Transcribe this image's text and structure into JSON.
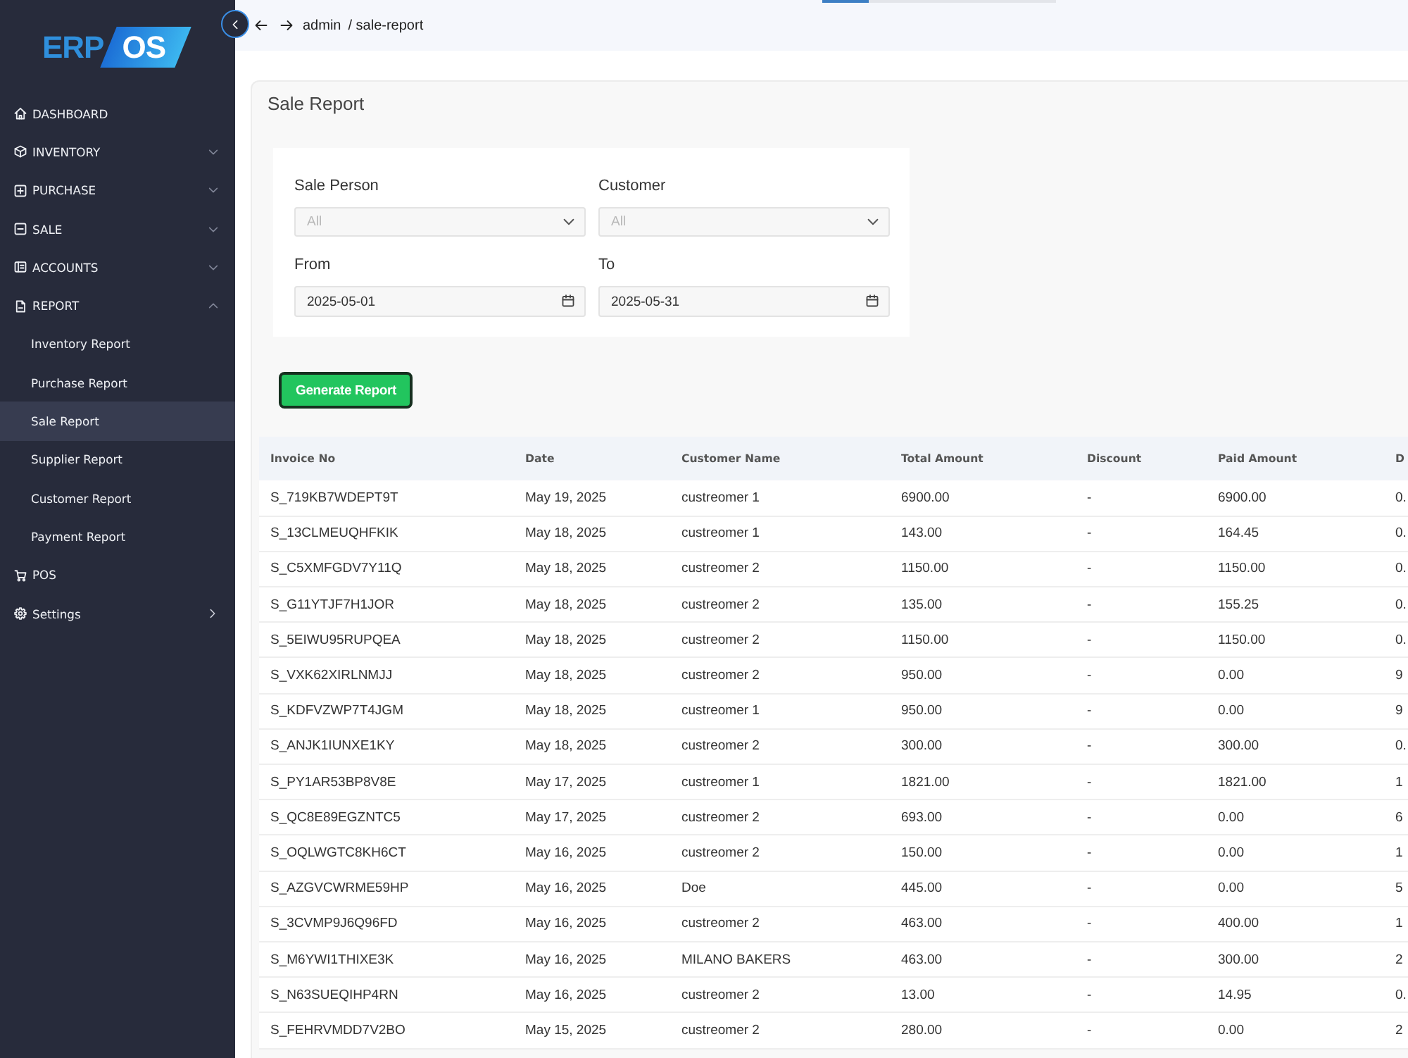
{
  "top_progress": {
    "level": 0.2
  },
  "sidebar": {
    "logo": {
      "text": "ERP",
      "badge": "OS"
    },
    "items": [
      {
        "label": "DASHBOARD",
        "kind": "link"
      },
      {
        "label": "INVENTORY",
        "kind": "group",
        "expanded": false
      },
      {
        "label": "PURCHASE",
        "kind": "group",
        "expanded": false
      },
      {
        "label": "SALE",
        "kind": "group",
        "expanded": false
      },
      {
        "label": "ACCOUNTS",
        "kind": "group",
        "expanded": false
      },
      {
        "label": "REPORT",
        "kind": "group",
        "expanded": true,
        "children": [
          {
            "label": "Inventory Report",
            "selected": false
          },
          {
            "label": "Purchase Report",
            "selected": false
          },
          {
            "label": "Sale Report",
            "selected": true
          },
          {
            "label": "Supplier Report",
            "selected": false
          },
          {
            "label": "Customer Report",
            "selected": false
          },
          {
            "label": "Payment Report",
            "selected": false
          }
        ]
      },
      {
        "label": "POS",
        "kind": "link"
      },
      {
        "label": "Settings",
        "kind": "flyout"
      }
    ]
  },
  "topbar": {
    "breadcrumb": {
      "user": "admin",
      "path": "/ sale-report"
    }
  },
  "page": {
    "title": "Sale Report",
    "filters": [
      {
        "label": "Sale Person",
        "kind": "select",
        "placeholder": "All"
      },
      {
        "label": "Customer",
        "kind": "select",
        "placeholder": "All"
      },
      {
        "label": "From",
        "kind": "date",
        "value": "2025-05-01"
      },
      {
        "label": "To",
        "kind": "date",
        "value": "2025-05-31"
      }
    ],
    "generate_button": "Generate Report",
    "table": {
      "columns": [
        "Invoice No",
        "Date",
        "Customer Name",
        "Total Amount",
        "Discount",
        "Paid Amount",
        "D"
      ],
      "rows": [
        [
          "S_719KB7WDEPT9T",
          "May 19, 2025",
          "custreomer 1",
          "6900.00",
          "-",
          "6900.00",
          "0."
        ],
        [
          "S_13CLMEUQHFKIK",
          "May 18, 2025",
          "custreomer 1",
          "143.00",
          "-",
          "164.45",
          "0."
        ],
        [
          "S_C5XMFGDV7Y11Q",
          "May 18, 2025",
          "custreomer 2",
          "1150.00",
          "-",
          "1150.00",
          "0."
        ],
        [
          "S_G11YTJF7H1JOR",
          "May 18, 2025",
          "custreomer 2",
          "135.00",
          "-",
          "155.25",
          "0."
        ],
        [
          "S_5EIWU95RUPQEA",
          "May 18, 2025",
          "custreomer 2",
          "1150.00",
          "-",
          "1150.00",
          "0."
        ],
        [
          "S_VXK62XIRLNMJJ",
          "May 18, 2025",
          "custreomer 2",
          "950.00",
          "-",
          "0.00",
          "9"
        ],
        [
          "S_KDFVZWP7T4JGM",
          "May 18, 2025",
          "custreomer 1",
          "950.00",
          "-",
          "0.00",
          "9"
        ],
        [
          "S_ANJK1IUNXE1KY",
          "May 18, 2025",
          "custreomer 2",
          "300.00",
          "-",
          "300.00",
          "0."
        ],
        [
          "S_PY1AR53BP8V8E",
          "May 17, 2025",
          "custreomer 1",
          "1821.00",
          "-",
          "1821.00",
          "1"
        ],
        [
          "S_QC8E89EGZNTC5",
          "May 17, 2025",
          "custreomer 2",
          "693.00",
          "-",
          "0.00",
          "6"
        ],
        [
          "S_OQLWGTC8KH6CT",
          "May 16, 2025",
          "custreomer 2",
          "150.00",
          "-",
          "0.00",
          "1"
        ],
        [
          "S_AZGVCWRME59HP",
          "May 16, 2025",
          "Doe",
          "445.00",
          "-",
          "0.00",
          "5"
        ],
        [
          "S_3CVMP9J6Q96FD",
          "May 16, 2025",
          "custreomer 2",
          "463.00",
          "-",
          "400.00",
          "1"
        ],
        [
          "S_M6YWI1THIXE3K",
          "May 16, 2025",
          "MILANO BAKERS",
          "463.00",
          "-",
          "300.00",
          "2"
        ],
        [
          "S_N63SUEQIHP4RN",
          "May 16, 2025",
          "custreomer 2",
          "13.00",
          "-",
          "14.95",
          "0."
        ],
        [
          "S_FEHRVMDD7V2BO",
          "May 15, 2025",
          "custreomer 2",
          "280.00",
          "-",
          "0.00",
          "2"
        ]
      ]
    }
  }
}
